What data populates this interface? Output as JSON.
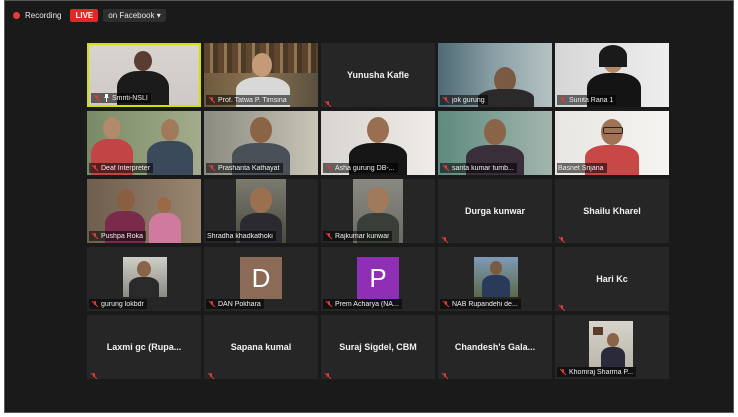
{
  "topbar": {
    "recording_label": "Recording",
    "live_label": "LIVE",
    "facebook_label": "on Facebook ▾"
  },
  "participants": [
    {
      "name": "Smriti-NSLI",
      "mode": "video",
      "caption": "Smriti-NSLI"
    },
    {
      "name": "Prof. Tatwa P. Timsina",
      "mode": "video",
      "caption": "Prof. Tatwa P. Timsina"
    },
    {
      "name": "Yunusha Kafle",
      "mode": "name",
      "caption": ""
    },
    {
      "name": "jok gurung",
      "mode": "video",
      "caption": "jok gurung"
    },
    {
      "name": "Sunita Rana 1",
      "mode": "video",
      "caption": "Sunita Rana 1"
    },
    {
      "name": "Deaf Interpreter",
      "mode": "video",
      "caption": "Deaf Interpreter"
    },
    {
      "name": "Prashanta Kathayat",
      "mode": "video",
      "caption": "Prashanta Kathayat"
    },
    {
      "name": "Asha gurung",
      "mode": "video",
      "caption": "Asha gurung  DB-..."
    },
    {
      "name": "santa kumar tumb...",
      "mode": "video",
      "caption": "santa kumar tumb..."
    },
    {
      "name": "Basnet Srijana",
      "mode": "video",
      "caption": "Basnet Srijana"
    },
    {
      "name": "Pushpa Roka",
      "mode": "video",
      "caption": "Pushpa Roka"
    },
    {
      "name": "Shradha khadkathoki",
      "mode": "video",
      "caption": "Shradha khadkathoki"
    },
    {
      "name": "Rajkumar kunwar",
      "mode": "video",
      "caption": "Rajkumar kunwar"
    },
    {
      "name": "Durga kunwar",
      "mode": "name",
      "caption": ""
    },
    {
      "name": "Shailu Kharel",
      "mode": "name",
      "caption": ""
    },
    {
      "name": "gurung lokbdr",
      "mode": "video",
      "caption": "gurung lokbdr"
    },
    {
      "name": "DAN Pokhara",
      "mode": "avatar",
      "initial": "D",
      "caption": "DAN Pokhara"
    },
    {
      "name": "Prem Acharya (NA...",
      "mode": "avatar",
      "initial": "P",
      "caption": "Prem Acharya (NA..."
    },
    {
      "name": "NAB Rupandehi de...",
      "mode": "video",
      "caption": "NAB Rupandehi de..."
    },
    {
      "name": "Hari Kc",
      "mode": "name",
      "caption": ""
    },
    {
      "name": "Laxmi gc (Rupa...",
      "mode": "name",
      "caption": ""
    },
    {
      "name": "Sapana kumal",
      "mode": "name",
      "caption": ""
    },
    {
      "name": "Suraj Sigdel, CBM",
      "mode": "name",
      "caption": ""
    },
    {
      "name": "Chandesh's  Gala...",
      "mode": "name",
      "caption": ""
    },
    {
      "name": "Khomraj Sharma P...",
      "mode": "video",
      "caption": "Khomraj Sharma P..."
    }
  ],
  "colors": {
    "live": "#e02828",
    "active_speaker_border": "#d4e000",
    "muted_mic": "#e03a3a",
    "avatar_d": "#8b6a58",
    "avatar_p": "#8e2fb5"
  }
}
